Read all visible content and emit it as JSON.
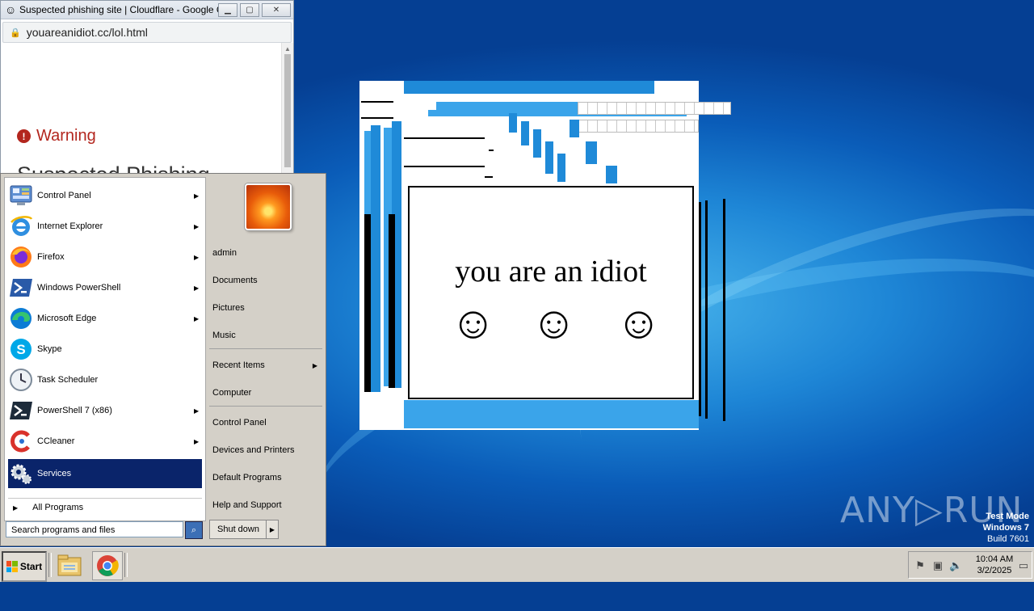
{
  "browser": {
    "tab_title": "Suspected phishing site | Cloudflare - Google C...",
    "url": "youareanidiot.cc/lol.html",
    "warning_label": "Warning",
    "page_heading": "Suspected Phishing"
  },
  "popup": {
    "message": "you are an idiot",
    "smileys": [
      "☺",
      "☺",
      "☺"
    ]
  },
  "start_menu": {
    "programs": [
      {
        "label": "Control Panel",
        "icon": "control-panel-icon",
        "submenu": true
      },
      {
        "label": "Internet Explorer",
        "icon": "internet-explorer-icon",
        "submenu": true
      },
      {
        "label": "Firefox",
        "icon": "firefox-icon",
        "submenu": true
      },
      {
        "label": "Windows PowerShell",
        "icon": "powershell-icon",
        "submenu": true
      },
      {
        "label": "Microsoft Edge",
        "icon": "edge-icon",
        "submenu": true
      },
      {
        "label": "Skype",
        "icon": "skype-icon",
        "submenu": false
      },
      {
        "label": "Task Scheduler",
        "icon": "task-scheduler-icon",
        "submenu": false
      },
      {
        "label": "PowerShell 7 (x86)",
        "icon": "powershell7-icon",
        "submenu": true
      },
      {
        "label": "CCleaner",
        "icon": "ccleaner-icon",
        "submenu": true
      },
      {
        "label": "Services",
        "icon": "services-gear-icon",
        "submenu": false,
        "selected": true
      }
    ],
    "all_programs": "All Programs",
    "search_placeholder": "Search programs and files",
    "right_items": {
      "user": "admin",
      "documents": "Documents",
      "pictures": "Pictures",
      "music": "Music",
      "recent_items": "Recent Items",
      "computer": "Computer",
      "control_panel": "Control Panel",
      "devices_printers": "Devices and Printers",
      "default_programs": "Default Programs",
      "help_support": "Help and Support"
    },
    "shutdown_label": "Shut down"
  },
  "taskbar": {
    "start_label": "Start",
    "pinned": [
      "file-explorer-icon",
      "chrome-icon"
    ],
    "clock_time": "10:04 AM",
    "clock_date": "3/2/2025"
  },
  "watermark": {
    "brand": "ANY▷RUN",
    "mode": "Test Mode",
    "os": "Windows 7",
    "build": "Build 7601"
  },
  "colors": {
    "selection": "#0a246a",
    "warning": "#b3261e",
    "desktop": "#1e86d6"
  }
}
